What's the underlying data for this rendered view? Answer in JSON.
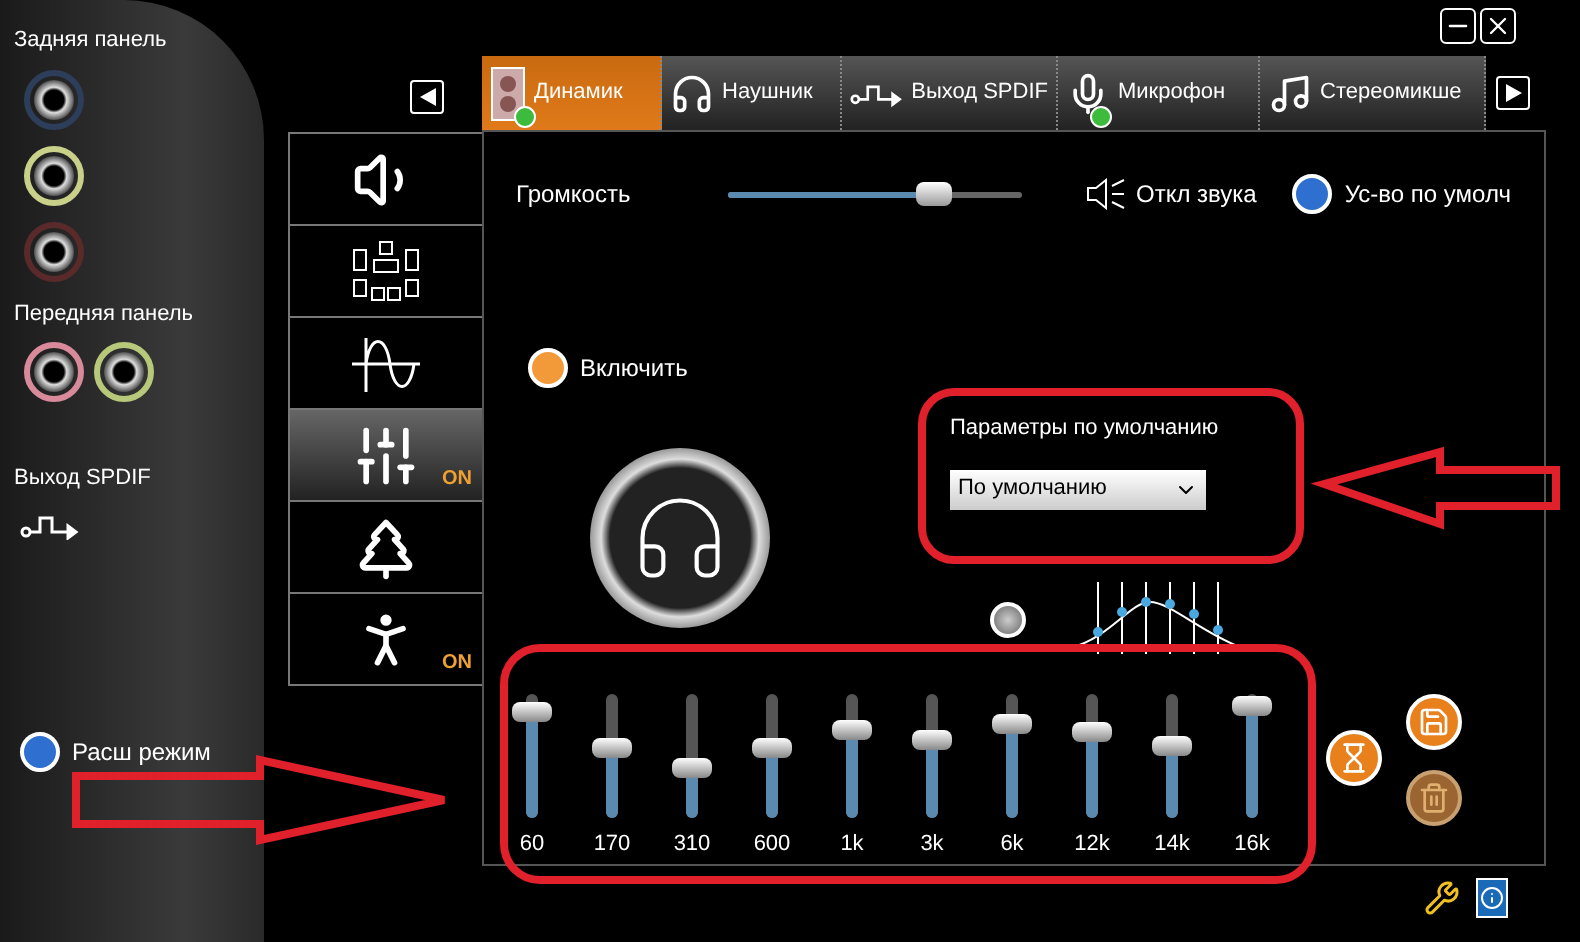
{
  "left_panel": {
    "rear_title": "Задняя панель",
    "rear_jacks": [
      {
        "color": "#2c3e5a"
      },
      {
        "color": "#c8d08a"
      },
      {
        "color": "#5a2a2a"
      }
    ],
    "front_title": "Передняя панель",
    "front_jacks": [
      {
        "color": "#d88a9a"
      },
      {
        "color": "#b8c87a"
      }
    ],
    "spdif_title": "Выход SPDIF",
    "advanced_mode": {
      "label": "Расш режим",
      "selected": true
    }
  },
  "tabs": [
    {
      "label": "Динамик",
      "kind": "speaker",
      "selected": true,
      "connected": true
    },
    {
      "label": "Наушник",
      "kind": "headphones",
      "selected": false,
      "connected": false
    },
    {
      "label": "Выход SPDIF",
      "kind": "spdif",
      "selected": false,
      "connected": false
    },
    {
      "label": "Микрофон",
      "kind": "mic",
      "selected": false,
      "connected": true
    },
    {
      "label": "Стереомикше",
      "kind": "music",
      "selected": false,
      "connected": false
    }
  ],
  "modes": [
    {
      "kind": "volume",
      "selected": false
    },
    {
      "kind": "surround",
      "selected": false
    },
    {
      "kind": "wave",
      "selected": false
    },
    {
      "kind": "equalizer",
      "selected": true,
      "badge": "ON"
    },
    {
      "kind": "environment",
      "selected": false
    },
    {
      "kind": "room",
      "selected": false,
      "badge": "ON"
    }
  ],
  "volume": {
    "label": "Громкость",
    "level": 0.7,
    "mute": "Откл звука",
    "default_device": {
      "label": "Ус-во по умолч",
      "selected": true
    }
  },
  "enable": {
    "label": "Включить",
    "selected": true
  },
  "preset": {
    "label": "Параметры по умолчанию",
    "value": "По умолчанию"
  },
  "bands": [
    {
      "label": "60",
      "level": 0.85
    },
    {
      "label": "170",
      "level": 0.55
    },
    {
      "label": "310",
      "level": 0.4
    },
    {
      "label": "600",
      "level": 0.55
    },
    {
      "label": "1k",
      "level": 0.7
    },
    {
      "label": "3k",
      "level": 0.62
    },
    {
      "label": "6k",
      "level": 0.75
    },
    {
      "label": "12k",
      "level": 0.68
    },
    {
      "label": "14k",
      "level": 0.58
    },
    {
      "label": "16k",
      "level": 0.9
    }
  ]
}
